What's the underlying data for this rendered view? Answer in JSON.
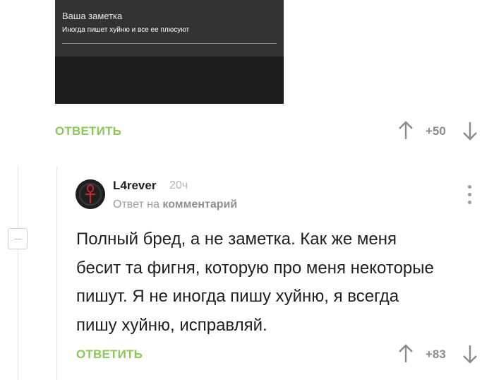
{
  "note_card": {
    "title": "Ваша заметка",
    "text": "Иногда пишет хуйню и все ее плюсуют"
  },
  "first_comment_actions": {
    "reply_label": "ОТВЕТИТЬ",
    "score": "+50"
  },
  "reply_comment": {
    "username": "L4rever",
    "time": "20ч",
    "reply_prefix": "Ответ на",
    "reply_target": "комментарий",
    "lines": [
      "Полный бред, а не заметка. Как же меня",
      "бесит та фигня, которую про меня некоторые",
      "пишут. Я не иногда пишу хуйню, я всегда",
      "пишу хуйню, исправляй."
    ],
    "reply_label": "ОТВЕТИТЬ",
    "score": "+83"
  },
  "colors": {
    "accent_green": "#8ac858",
    "muted_gray": "#8b8b8b",
    "dark_panel": "#1d1d1d"
  },
  "icons": [
    "arrow-up-icon",
    "arrow-down-icon",
    "more-vertical-icon",
    "collapse-minus-icon",
    "ankh-avatar"
  ]
}
